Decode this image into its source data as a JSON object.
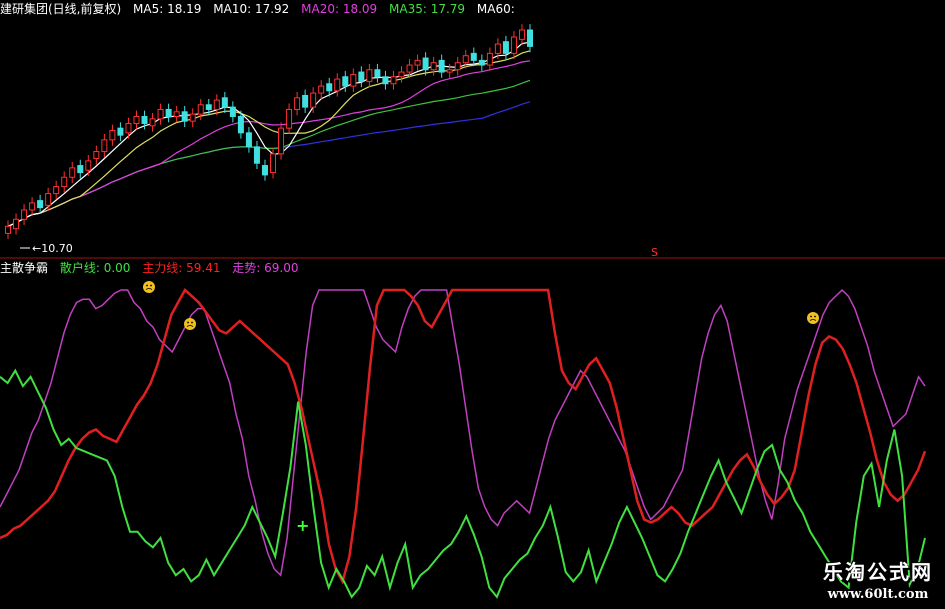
{
  "header_top": {
    "title": "建研集团(日线,前复权)",
    "ma": [
      {
        "label": "MA5: 18.19",
        "color": "#ffffff"
      },
      {
        "label": "MA10: 17.92",
        "color": "#ffffff"
      },
      {
        "label": "MA20: 18.09",
        "color": "#e040e0"
      },
      {
        "label": "MA35: 17.79",
        "color": "#40e040"
      },
      {
        "label": "MA60:",
        "color": "#ffffff"
      }
    ]
  },
  "header_bottom": {
    "name": "主散争霸",
    "items": [
      {
        "label": "散户线: 0.00",
        "color": "#40e040"
      },
      {
        "label": "主力线: 59.41",
        "color": "#ff2020"
      },
      {
        "label": "走势: 69.00",
        "color": "#e040e0"
      }
    ]
  },
  "low_marker": "10.70",
  "s_marker": "S",
  "watermark": {
    "line1": "乐淘公式网",
    "line2": "www.60lt.com"
  },
  "colors": {
    "up": "#ff3030",
    "down": "#40e0e0",
    "retail": "#40e040",
    "main": "#e02020",
    "trend": "#c040c0",
    "ma5": "#ffffff",
    "ma10": "#e0e060",
    "ma20": "#e040e0",
    "ma35": "#40c040",
    "ma60": "#3030e0",
    "ma120": "#c0c0c0"
  },
  "chart_data": [
    {
      "type": "candlestick",
      "title": "建研集团(日线,前复权)",
      "annotations": [
        "10.70"
      ],
      "ma_values": {
        "MA5": 18.19,
        "MA10": 17.92,
        "MA20": 18.09,
        "MA35": 17.79
      },
      "price_range": [
        10.7,
        19.6
      ],
      "closes": [
        11.2,
        11.5,
        11.9,
        12.2,
        12.0,
        12.6,
        12.9,
        13.3,
        13.7,
        13.5,
        14.0,
        14.4,
        14.9,
        15.3,
        15.1,
        15.6,
        15.9,
        15.6,
        15.8,
        16.2,
        15.9,
        16.1,
        15.7,
        16.0,
        16.4,
        16.2,
        16.6,
        16.3,
        15.9,
        15.2,
        14.6,
        13.9,
        13.4,
        14.3,
        15.4,
        16.2,
        16.7,
        16.3,
        16.9,
        17.2,
        17.0,
        17.5,
        17.2,
        17.7,
        17.4,
        17.9,
        17.6,
        17.3,
        17.6,
        17.8,
        18.1,
        18.3,
        17.9,
        18.2,
        17.8,
        17.9,
        18.2,
        18.5,
        18.3,
        18.1,
        18.6,
        19.0,
        18.6,
        19.3,
        19.6,
        18.9
      ],
      "opens": [
        10.9,
        11.1,
        11.5,
        11.9,
        12.3,
        12.1,
        12.6,
        12.9,
        13.3,
        13.8,
        13.6,
        14.1,
        14.4,
        14.9,
        15.4,
        15.2,
        15.6,
        15.9,
        15.5,
        15.8,
        16.2,
        15.9,
        16.1,
        15.7,
        16.0,
        16.4,
        16.2,
        16.7,
        16.3,
        15.9,
        15.2,
        14.6,
        13.8,
        13.5,
        14.3,
        15.4,
        16.2,
        16.8,
        16.3,
        16.9,
        17.3,
        17.0,
        17.6,
        17.2,
        17.8,
        17.4,
        17.9,
        17.6,
        17.3,
        17.6,
        17.8,
        18.1,
        18.4,
        17.9,
        18.3,
        17.8,
        17.9,
        18.2,
        18.6,
        18.3,
        18.1,
        18.6,
        19.1,
        18.6,
        19.2,
        19.6
      ]
    },
    {
      "type": "line",
      "title": "主散争霸",
      "series": [
        {
          "name": "散户线",
          "last": 0.0,
          "values": [
            72,
            70,
            74,
            69,
            72,
            67,
            62,
            55,
            50,
            52,
            49,
            48,
            47,
            46,
            45,
            40,
            30,
            22,
            22,
            19,
            17,
            20,
            12,
            8,
            10,
            6,
            8,
            13,
            8,
            12,
            16,
            20,
            24,
            30,
            25,
            20,
            14,
            28,
            43,
            64,
            50,
            30,
            12,
            4,
            10,
            6,
            1,
            4,
            11,
            8,
            14,
            4,
            12,
            18,
            4,
            8,
            10,
            13,
            16,
            18,
            22,
            27,
            21,
            14,
            4,
            1,
            7,
            10,
            13,
            15,
            20,
            24,
            30,
            20,
            9,
            6,
            9,
            16,
            6,
            12,
            18,
            25,
            30,
            25,
            20,
            14,
            8,
            6,
            10,
            15,
            22,
            28,
            34,
            40,
            45,
            38,
            33,
            28,
            35,
            42,
            48,
            50,
            42,
            38,
            32,
            28,
            22,
            18,
            14,
            10,
            6,
            4,
            25,
            40,
            44,
            30,
            45,
            55,
            40,
            5,
            10,
            20
          ]
        },
        {
          "name": "主力线",
          "last": 59.41,
          "values": [
            20,
            21,
            23,
            24,
            26,
            28,
            30,
            32,
            35,
            40,
            45,
            49,
            52,
            54,
            55,
            53,
            52,
            51,
            55,
            59,
            63,
            66,
            70,
            76,
            84,
            92,
            96,
            100,
            98,
            96,
            93,
            90,
            87,
            86,
            88,
            90,
            88,
            86,
            84,
            82,
            80,
            78,
            76,
            70,
            62,
            52,
            42,
            32,
            18,
            10,
            6,
            14,
            30,
            52,
            75,
            95,
            100,
            100,
            100,
            100,
            98,
            95,
            90,
            88,
            92,
            96,
            100,
            100,
            100,
            100,
            100,
            100,
            100,
            100,
            100,
            100,
            100,
            100,
            100,
            100,
            100,
            86,
            74,
            70,
            68,
            72,
            76,
            78,
            74,
            70,
            62,
            52,
            42,
            32,
            26,
            25,
            26,
            28,
            30,
            28,
            25,
            24,
            26,
            28,
            30,
            34,
            38,
            42,
            45,
            47,
            43,
            38,
            34,
            31,
            33,
            36,
            42,
            54,
            66,
            76,
            83,
            85,
            84,
            81,
            76,
            70,
            62,
            54,
            45,
            38,
            34,
            32,
            34,
            38,
            42,
            48
          ]
        },
        {
          "name": "走势",
          "last": 69.0,
          "values": [
            30,
            34,
            38,
            42,
            48,
            54,
            58,
            64,
            70,
            78,
            86,
            92,
            96,
            97,
            97,
            94,
            95,
            97,
            99,
            100,
            100,
            96,
            94,
            90,
            88,
            84,
            82,
            80,
            84,
            88,
            92,
            94,
            94,
            88,
            82,
            76,
            70,
            60,
            52,
            40,
            32,
            22,
            15,
            10,
            8,
            20,
            40,
            60,
            80,
            95,
            100,
            100,
            100,
            100,
            100,
            100,
            100,
            100,
            94,
            88,
            84,
            82,
            80,
            88,
            94,
            98,
            100,
            100,
            100,
            100,
            100,
            88,
            76,
            62,
            48,
            36,
            30,
            26,
            24,
            28,
            30,
            32,
            30,
            28,
            36,
            44,
            52,
            58,
            62,
            66,
            70,
            74,
            72,
            68,
            64,
            60,
            56,
            52,
            48,
            42,
            36,
            30,
            26,
            28,
            30,
            34,
            38,
            42,
            54,
            66,
            78,
            86,
            92,
            95,
            90,
            80,
            70,
            60,
            50,
            40,
            32,
            26,
            38,
            52,
            60,
            68,
            74,
            80,
            86,
            92,
            96,
            98,
            100,
            98,
            94,
            88,
            82,
            74,
            68,
            62,
            56,
            58,
            60,
            66,
            72,
            69
          ]
        }
      ],
      "ylim": [
        0,
        100
      ],
      "annotations": [
        "+"
      ]
    }
  ]
}
